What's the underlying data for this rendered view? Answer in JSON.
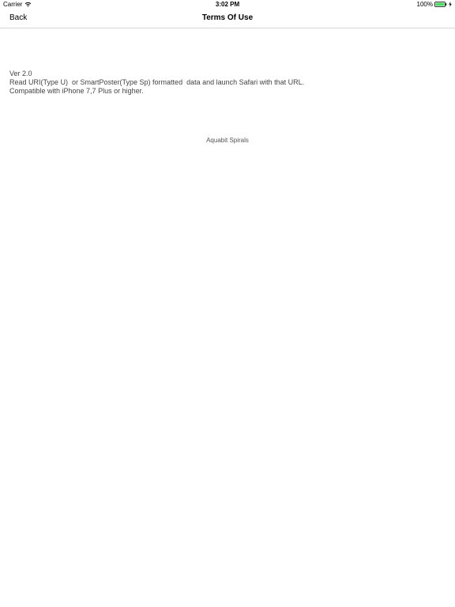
{
  "status_bar": {
    "carrier": "Carrier",
    "time": "3:02 PM",
    "battery_percent": "100%",
    "battery_level": 1.0,
    "battery_color": "#4cd964",
    "icons": [
      "wifi-icon",
      "battery-icon",
      "charging-icon"
    ]
  },
  "nav": {
    "back_label": "Back",
    "title": "Terms Of Use"
  },
  "content": {
    "lines": [
      "Ver 2.0",
      "Read URI(Type U)  or SmartPoster(Type Sp) formatted  data and launch Safari with that URL.",
      "Compatible with iPhone 7,7 Plus or higher."
    ]
  },
  "footer": {
    "credit": "Aquabit Spirals"
  }
}
